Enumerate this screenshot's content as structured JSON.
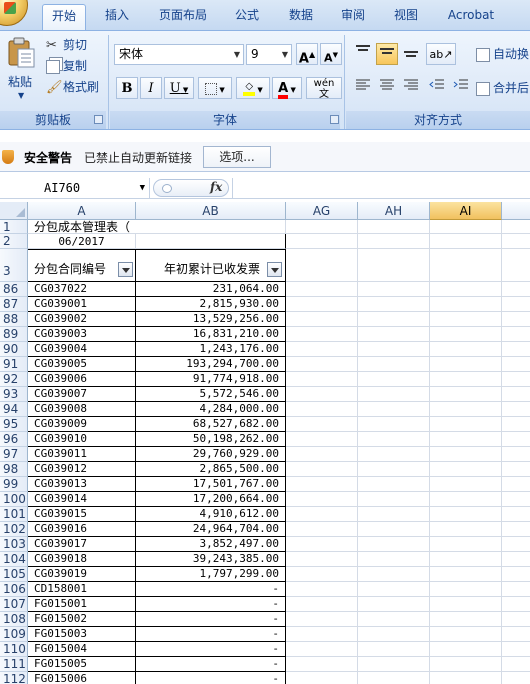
{
  "tabs": [
    "开始",
    "插入",
    "页面布局",
    "公式",
    "数据",
    "审阅",
    "视图",
    "Acrobat"
  ],
  "clipboard": {
    "paste": "粘贴",
    "cut": "剪切",
    "copy": "复制",
    "format_painter": "格式刷",
    "group": "剪贴板"
  },
  "font": {
    "name": "宋体",
    "size": "9",
    "bold": "B",
    "italic": "I",
    "underline": "U",
    "group": "字体",
    "grow": "A",
    "shrink": "A",
    "phonetic": "wén"
  },
  "alignment": {
    "wrap": "自动换",
    "merge": "合并后",
    "group": "对齐方式"
  },
  "security": {
    "title": "安全警告",
    "message": "已禁止自动更新链接",
    "options": "选项..."
  },
  "formula_bar": {
    "name_box": "AI760",
    "fx": "fx",
    "formula": ""
  },
  "columns": [
    "A",
    "AB",
    "AG",
    "AH",
    "AI"
  ],
  "sheet": {
    "title": "分包成本管理表（",
    "date": "06/2017",
    "header_a": "分包合同编号",
    "header_ab": "年初累计已收发票",
    "rows": [
      {
        "row": "86",
        "code": "CG037022",
        "amount": "231,064.00"
      },
      {
        "row": "87",
        "code": "CG039001",
        "amount": "2,815,930.00"
      },
      {
        "row": "88",
        "code": "CG039002",
        "amount": "13,529,256.00"
      },
      {
        "row": "89",
        "code": "CG039003",
        "amount": "16,831,210.00"
      },
      {
        "row": "90",
        "code": "CG039004",
        "amount": "1,243,176.00"
      },
      {
        "row": "91",
        "code": "CG039005",
        "amount": "193,294,700.00"
      },
      {
        "row": "92",
        "code": "CG039006",
        "amount": "91,774,918.00"
      },
      {
        "row": "93",
        "code": "CG039007",
        "amount": "5,572,546.00"
      },
      {
        "row": "94",
        "code": "CG039008",
        "amount": "4,284,000.00"
      },
      {
        "row": "95",
        "code": "CG039009",
        "amount": "68,527,682.00"
      },
      {
        "row": "96",
        "code": "CG039010",
        "amount": "50,198,262.00"
      },
      {
        "row": "97",
        "code": "CG039011",
        "amount": "29,760,929.00"
      },
      {
        "row": "98",
        "code": "CG039012",
        "amount": "2,865,500.00"
      },
      {
        "row": "99",
        "code": "CG039013",
        "amount": "17,501,767.00"
      },
      {
        "row": "100",
        "code": "CG039014",
        "amount": "17,200,664.00"
      },
      {
        "row": "101",
        "code": "CG039015",
        "amount": "4,910,612.00"
      },
      {
        "row": "102",
        "code": "CG039016",
        "amount": "24,964,704.00"
      },
      {
        "row": "103",
        "code": "CG039017",
        "amount": "3,852,497.00"
      },
      {
        "row": "104",
        "code": "CG039018",
        "amount": "39,243,385.00"
      },
      {
        "row": "105",
        "code": "CG039019",
        "amount": "1,797,299.00"
      },
      {
        "row": "106",
        "code": "CD158001",
        "amount": "-"
      },
      {
        "row": "107",
        "code": "FG015001",
        "amount": "-"
      },
      {
        "row": "108",
        "code": "FG015002",
        "amount": "-"
      },
      {
        "row": "109",
        "code": "FG015003",
        "amount": "-"
      },
      {
        "row": "110",
        "code": "FG015004",
        "amount": "-"
      },
      {
        "row": "111",
        "code": "FG015005",
        "amount": "-"
      },
      {
        "row": "112",
        "code": "FG015006",
        "amount": "-"
      }
    ]
  }
}
